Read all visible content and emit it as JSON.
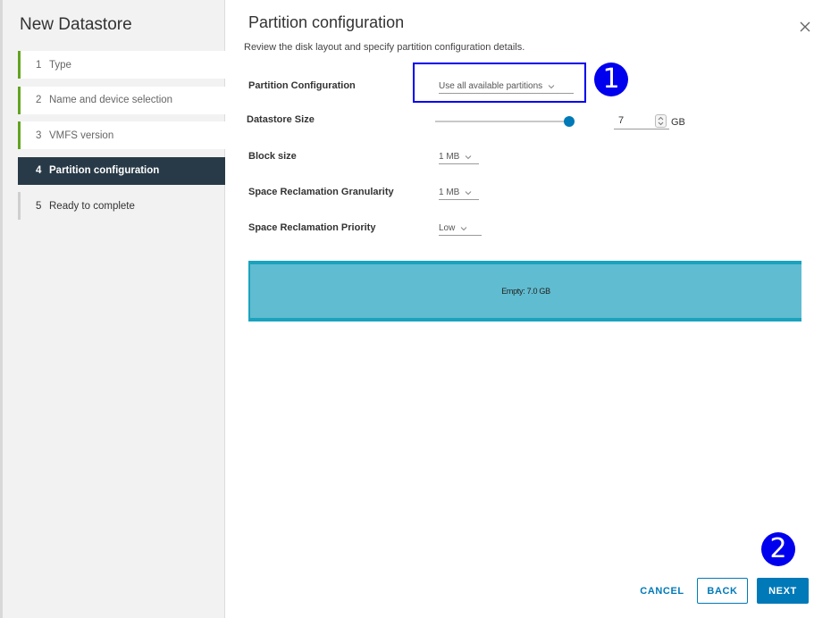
{
  "wizard": {
    "title": "New Datastore",
    "steps": [
      {
        "num": "1",
        "label": "Type"
      },
      {
        "num": "2",
        "label": "Name and device selection"
      },
      {
        "num": "3",
        "label": "VMFS version"
      },
      {
        "num": "4",
        "label": "Partition configuration"
      },
      {
        "num": "5",
        "label": "Ready to complete"
      }
    ]
  },
  "page": {
    "title": "Partition configuration",
    "subtitle": "Review the disk layout and specify partition configuration details."
  },
  "form": {
    "partition_configuration": {
      "label": "Partition Configuration",
      "value": "Use all available partitions"
    },
    "datastore_size": {
      "label": "Datastore Size",
      "value": "7",
      "unit": "GB",
      "slider_fraction": 1.0
    },
    "block_size": {
      "label": "Block size",
      "value": "1 MB"
    },
    "reclamation_granularity": {
      "label": "Space Reclamation Granularity",
      "value": "1 MB"
    },
    "reclamation_priority": {
      "label": "Space Reclamation Priority",
      "value": "Low"
    }
  },
  "disk_layout": {
    "label": "Empty: 7.0 GB"
  },
  "annotations": {
    "marker_1": "1",
    "marker_2": "2"
  },
  "buttons": {
    "cancel": "CANCEL",
    "back": "BACK",
    "next": "NEXT"
  },
  "colors": {
    "accent": "#0079b8",
    "active_step_bg": "#283a47",
    "completed_step_bar": "#62a420",
    "disk_border": "#1aa3bf",
    "disk_fill": "#60bcd0",
    "annotation": "#0000ee"
  },
  "icons": {
    "close": "close-icon",
    "dropdown": "chevron-down-icon",
    "spinner": "spinner-icon"
  }
}
